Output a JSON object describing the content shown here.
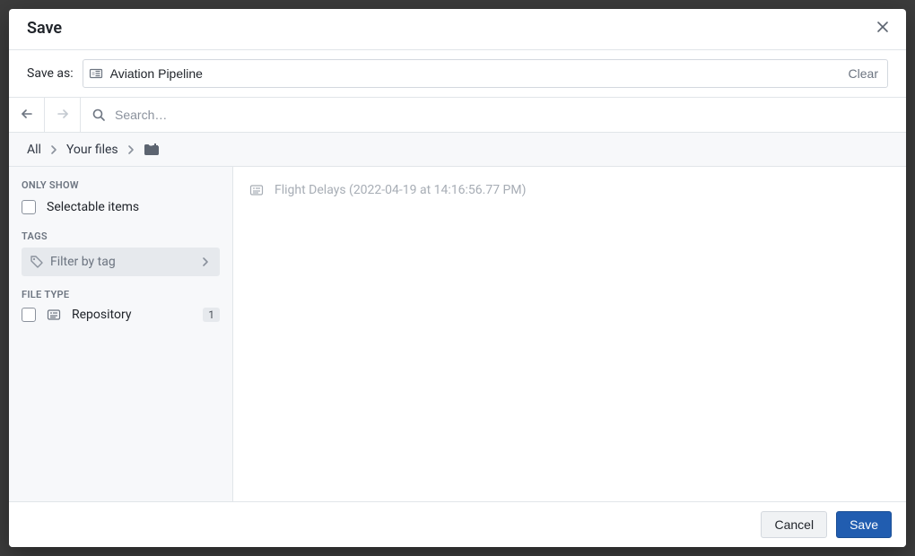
{
  "dialog": {
    "title": "Save",
    "save_as_label": "Save as:",
    "save_as_value": "Aviation Pipeline",
    "clear_label": "Clear",
    "search_placeholder": "Search…"
  },
  "breadcrumb": {
    "all": "All",
    "your_files": "Your files"
  },
  "sidebar": {
    "only_show_label": "ONLY SHOW",
    "selectable_items_label": "Selectable items",
    "tags_label": "TAGS",
    "filter_by_tag": "Filter by tag",
    "file_type_label": "FILE TYPE",
    "file_types": [
      {
        "label": "Repository",
        "count": "1"
      }
    ]
  },
  "content": {
    "items": [
      {
        "label": "Flight Delays (2022-04-19 at 14:16:56.77 PM)"
      }
    ]
  },
  "footer": {
    "cancel": "Cancel",
    "save": "Save"
  }
}
